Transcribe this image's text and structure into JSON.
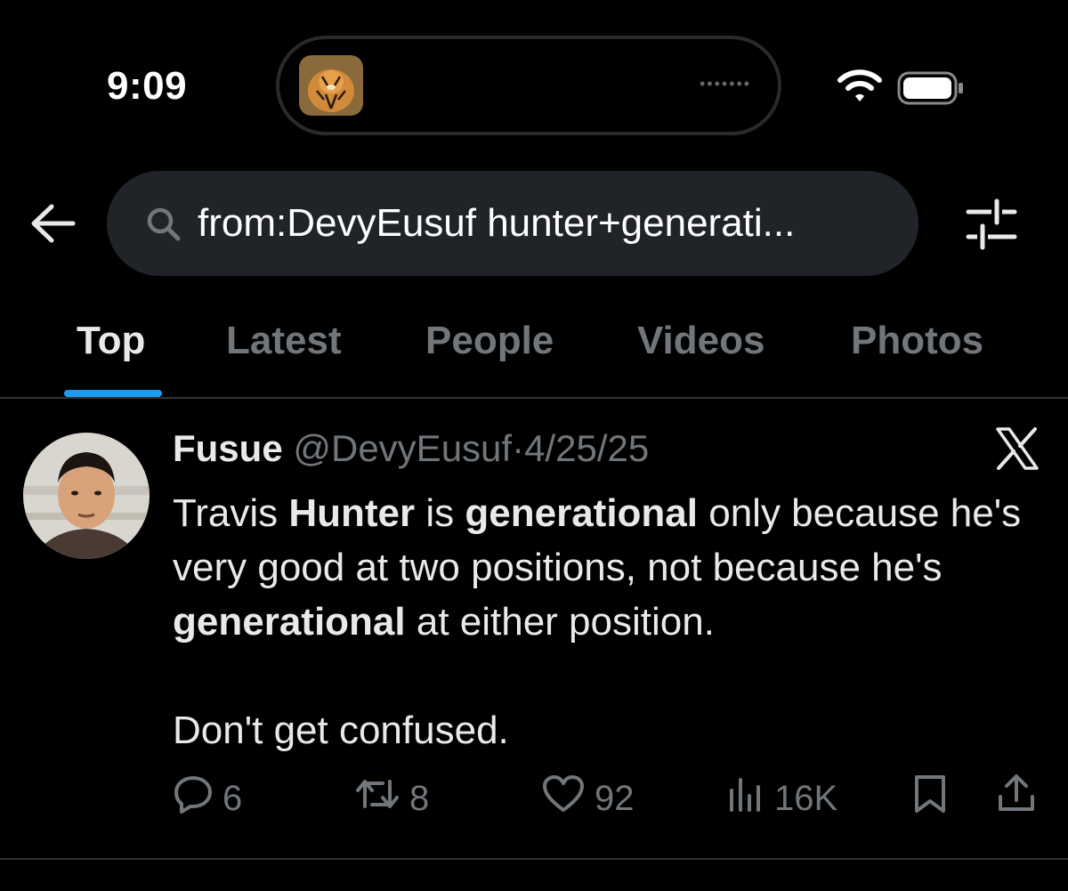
{
  "status_bar": {
    "time": "9:09",
    "island_dots": "•••••••"
  },
  "search": {
    "query": "from:DevyEusuf hunter+generati..."
  },
  "tabs": [
    {
      "label": "Top",
      "active": true
    },
    {
      "label": "Latest",
      "active": false
    },
    {
      "label": "People",
      "active": false
    },
    {
      "label": "Videos",
      "active": false
    },
    {
      "label": "Photos",
      "active": false
    }
  ],
  "tweet": {
    "author_name": "Fusue",
    "handle": "@DevyEusuf",
    "separator": "·",
    "date": "4/25/25",
    "text_parts": {
      "p1_a": "Travis ",
      "p1_b": "Hunter",
      "p1_c": " is ",
      "p1_d": "generational",
      "p1_e": " only because he's very good at two positions, not because he's ",
      "p1_f": "generational",
      "p1_g": " at either position.",
      "p2": "Don't get confused."
    },
    "actions": {
      "replies": "6",
      "retweets": "8",
      "likes": "92",
      "views": "16K"
    }
  },
  "colors": {
    "background": "#000000",
    "accent": "#1d9bf0",
    "muted": "#71767b",
    "text": "#e7e9ea",
    "search_bg": "#202327"
  }
}
